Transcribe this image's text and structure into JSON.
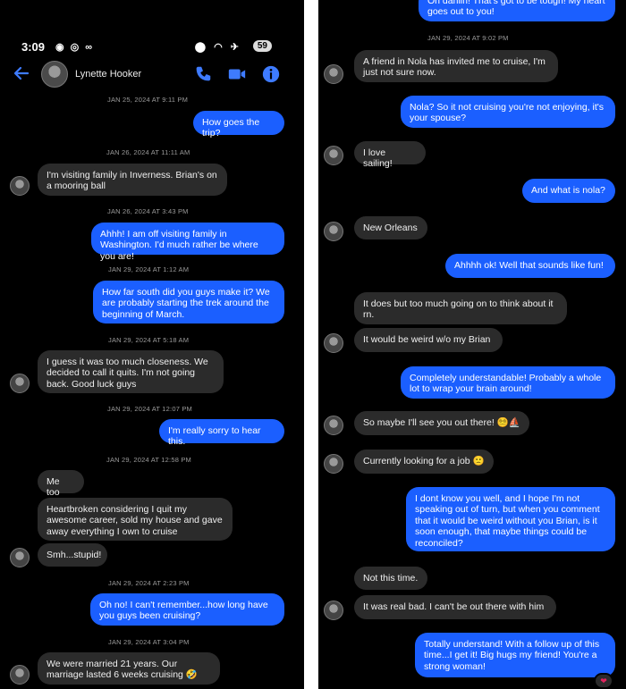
{
  "status": {
    "time": "3:09",
    "battery": "59"
  },
  "contact": {
    "name": "Lynette Hooker"
  },
  "left": [
    {
      "kind": "ts",
      "text": "JAN 25, 2024 AT 9:11 PM"
    },
    {
      "kind": "sent",
      "text": "How goes the trip?"
    },
    {
      "kind": "ts",
      "text": "JAN 26, 2024 AT 11:11 AM"
    },
    {
      "kind": "recv",
      "text": "I'm visiting family in Inverness. Brian's on a mooring ball"
    },
    {
      "kind": "ts",
      "text": "JAN 26, 2024 AT 3:43 PM"
    },
    {
      "kind": "sent",
      "text": "Ahhh! I am off visiting family in Washington. I'd much rather be where you are!"
    },
    {
      "kind": "ts",
      "text": "JAN 29, 2024 AT 1:12 AM"
    },
    {
      "kind": "sent",
      "text": "How far south did you guys make it? We are probably starting the trek around the beginning of March."
    },
    {
      "kind": "ts",
      "text": "JAN 29, 2024 AT 5:18 AM"
    },
    {
      "kind": "recv",
      "text": "I guess it was too much closeness. We decided to call it quits. I'm not going back. Good luck guys"
    },
    {
      "kind": "ts",
      "text": "JAN 29, 2024 AT 12:07 PM"
    },
    {
      "kind": "sent",
      "text": "I'm really sorry to hear this."
    },
    {
      "kind": "ts",
      "text": "JAN 29, 2024 AT 12:58 PM"
    },
    {
      "kind": "recv",
      "text": "Me too"
    },
    {
      "kind": "recv",
      "text": "Heartbroken considering I quit my awesome career, sold my house and gave away everything I own to cruise"
    },
    {
      "kind": "recv",
      "text": "Smh...stupid!"
    },
    {
      "kind": "ts",
      "text": "JAN 29, 2024 AT 2:23 PM"
    },
    {
      "kind": "sent",
      "text": "Oh no! I can't remember...how long have you guys been cruising?"
    },
    {
      "kind": "ts",
      "text": "JAN 29, 2024 AT 3:04 PM"
    },
    {
      "kind": "recv",
      "text": "We were married 21 years. Our marriage lasted 6 weeks cruising 🤣"
    }
  ],
  "right": [
    {
      "kind": "sent",
      "text": "Oh dahlin! That's got to be tough! My heart goes out to you!"
    },
    {
      "kind": "ts",
      "text": "JAN 29, 2024 AT 9:02 PM"
    },
    {
      "kind": "recv",
      "text": "A friend in Nola has invited me to cruise, I'm just not sure now."
    },
    {
      "kind": "sent",
      "text": "Nola? So it not cruising you're not enjoying, it's your spouse?"
    },
    {
      "kind": "recv",
      "text": "I love sailing!"
    },
    {
      "kind": "sent",
      "text": "And what is nola?"
    },
    {
      "kind": "recv",
      "text": "New Orleans"
    },
    {
      "kind": "sent",
      "text": "Ahhhh ok! Well that sounds like fun!"
    },
    {
      "kind": "recv",
      "text": "It does but too much going on to think about it rn."
    },
    {
      "kind": "recv",
      "text": "It would be weird w/o my Brian"
    },
    {
      "kind": "sent",
      "text": "Completely understandable! Probably a whole lot to wrap your brain around!"
    },
    {
      "kind": "recv",
      "text": "So maybe I'll see you out there! 😵‍💫⛵"
    },
    {
      "kind": "recv",
      "text": "Currently looking for a job 🙁"
    },
    {
      "kind": "sent",
      "text": "I dont know you well, and I hope I'm not speaking out of turn, but when you comment that it would be weird without you Brian, is it soon enough, that maybe things could be reconciled?"
    },
    {
      "kind": "recv",
      "text": "Not this time."
    },
    {
      "kind": "recv",
      "text": "It was real bad. I can't be out there with him"
    },
    {
      "kind": "sent",
      "text": "Totally understand! With a follow up of this time...I get it! Big hugs my friend! You're a strong woman!"
    }
  ],
  "reaction": "❤"
}
